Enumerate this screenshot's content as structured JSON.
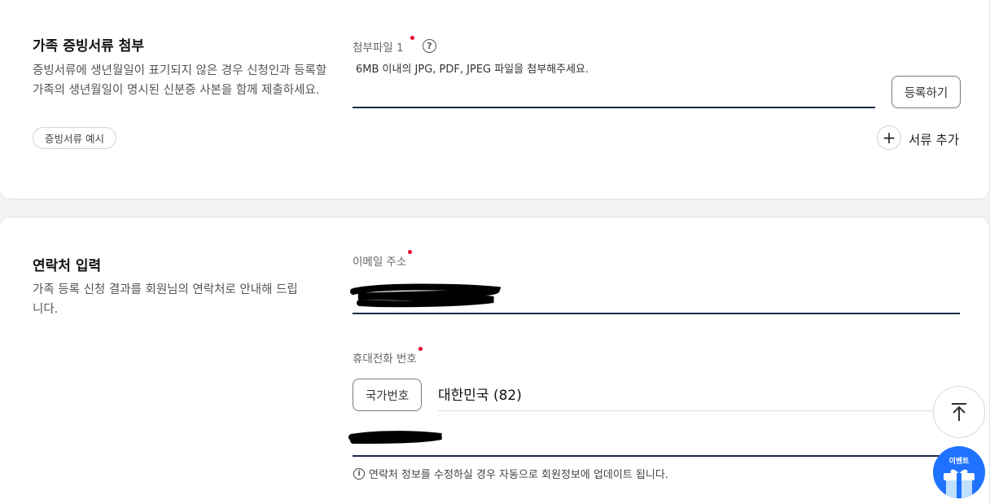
{
  "attachments": {
    "title": "가족 증빙서류 첨부",
    "description": "증빙서류에 생년월일이 표기되지 않은 경우 신청인과 등록할 가족의 생년월일이 명시된 신분증 사본을 함께 제출하세요.",
    "example_button": "증빙서류 예시",
    "file_label": "첨부파일 1",
    "help_glyph": "?",
    "file_hint": "6MB 이내의 JPG, PDF, JPEG 파일을 첨부해주세요.",
    "register_button": "등록하기",
    "add_plus_glyph": "+",
    "add_document": "서류 추가"
  },
  "contact": {
    "title": "연락처 입력",
    "description": "가족 등록 신청 결과를 회원님의 연락처로 안내해 드립니다.",
    "email_label": "이메일 주소",
    "phone_label": "휴대전화 번호",
    "country_code_button": "국가번호",
    "country_value": "대한민국 (82)",
    "info_glyph": "i",
    "info_text": "연락처 정보를 수정하실 경우 자동으로 회원정보에 업데이트 됩니다."
  },
  "floating": {
    "event_label": "이벤트"
  },
  "colors": {
    "required_dot": "#e4002b",
    "input_underline": "#1b2a47",
    "event_blue": "#1f72ff"
  }
}
